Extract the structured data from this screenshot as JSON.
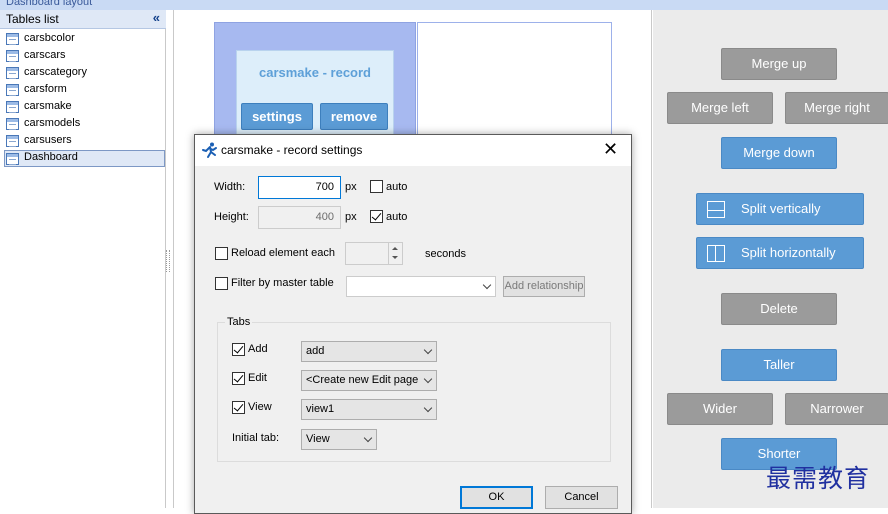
{
  "app": {
    "title": "Dashboard layout"
  },
  "tables_panel": {
    "title": "Tables list",
    "collapse_glyph": "«",
    "items": [
      {
        "label": "carsbcolor",
        "icon": "table-icon"
      },
      {
        "label": "carscars",
        "icon": "table-icon"
      },
      {
        "label": "carscategory",
        "icon": "table-icon"
      },
      {
        "label": "carsform",
        "icon": "table-icon"
      },
      {
        "label": "carsmake",
        "icon": "table-icon"
      },
      {
        "label": "carsmodels",
        "icon": "table-icon"
      },
      {
        "label": "carsusers",
        "icon": "table-icon"
      },
      {
        "label": "Dashboard",
        "icon": "dashboard-icon",
        "selected": true
      }
    ]
  },
  "canvas": {
    "element_title": "carsmake - record",
    "settings_label": "settings",
    "remove_label": "remove"
  },
  "right_panel": {
    "merge_up": "Merge up",
    "merge_left": "Merge left",
    "merge_right": "Merge right",
    "merge_down": "Merge down",
    "split_vertically": "Split vertically",
    "split_horizontally": "Split horizontally",
    "delete": "Delete",
    "taller": "Taller",
    "wider": "Wider",
    "narrower": "Narrower",
    "shorter": "Shorter"
  },
  "dialog": {
    "title": "carsmake - record settings",
    "close_glyph": "✕",
    "width_label": "Width:",
    "width_value": "700",
    "width_unit": "px",
    "width_auto_label": "auto",
    "width_auto_checked": false,
    "height_label": "Height:",
    "height_value": "400",
    "height_unit": "px",
    "height_auto_label": "auto",
    "height_auto_checked": true,
    "reload_label": "Reload element each",
    "reload_checked": false,
    "reload_value": "",
    "reload_unit": "seconds",
    "filter_label": "Filter by master table",
    "filter_checked": false,
    "filter_value": "",
    "add_relationship_label": "Add relationship",
    "tabs_group_label": "Tabs",
    "tab_add_label": "Add",
    "tab_add_checked": true,
    "tab_add_value": "add",
    "tab_edit_label": "Edit",
    "tab_edit_checked": true,
    "tab_edit_value": "<Create new Edit page",
    "tab_view_label": "View",
    "tab_view_checked": true,
    "tab_view_value": "view1",
    "initial_tab_label": "Initial tab:",
    "initial_tab_value": "View",
    "ok_label": "OK",
    "cancel_label": "Cancel"
  },
  "watermark": "最需教育",
  "colors": {
    "accent_blue": "#5b9bd5",
    "disabled_gray": "#9b9b9b",
    "cell_highlight": "#a7b9f0"
  }
}
